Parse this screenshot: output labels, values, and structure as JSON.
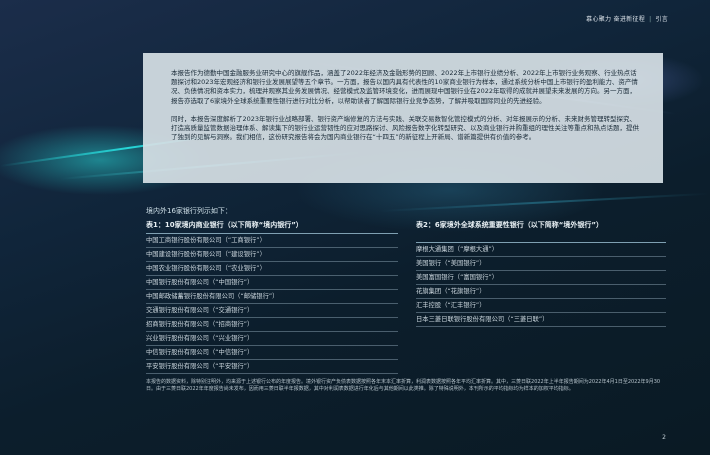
{
  "header": {
    "title": "慕心聚力 奋进新征程",
    "section": "引言"
  },
  "intro": {
    "paragraph1": "本报告作为德勤中国金融服务业研究中心的旗舰作品，涵盖了2022年经济及金融形势的回顾、2022年上市银行业绩分析、2022年上市银行业务观察、行业热点话题探讨和2023年宏观经济和银行业发展展望等五个章节。一方面，报告以国内具有代表性的10家商业银行为样本，通过系统分析中国上市银行的盈利能力、资产情况、负债情况和资本实力，梳理并观察其业务发展情况、经营模式及监管环境变化，进而展现中国银行业在2022年取得的成就并展望未来发展的方向。另一方面，报告亦选取了6家境外全球系统重要性银行进行对比分析，以帮助读者了解国际银行业竞争态势，了解并吸取国际同业的先进经验。",
    "paragraph2": "同时，本报告深度解析了2023年银行业战略部署、银行资产端修复的方法与实践、关联交易数智化管控模式的分析、对年报展示的分析、未来财务管理转型探究、打造高质量监管数据治理体系、解读集下的银行业运营韧性的应对思路探讨、风险报告数字化转型研究、以及商业银行并购重组的理性关注等重点和热点话题，提供了独到的见解与洞察。我们相信，这份研究报告将会为国内商业银行在“十四五”的新征程上开新局、谱新篇提供有价值的参考。"
  },
  "lead": "境内外16家银行列示如下：",
  "table_left": {
    "title": "表1：10家境内商业银行（以下简称“境内银行”）",
    "rows": [
      "中国工商银行股份有限公司（“工商银行”）",
      "中国建设银行股份有限公司（“建设银行”）",
      "中国农业银行股份有限公司（“农业银行”）",
      "中国银行股份有限公司（“中国银行”）",
      "中国邮政储蓄银行股份有限公司（“邮储银行”）",
      "交通银行股份有限公司（“交通银行”）",
      "招商银行股份有限公司（“招商银行”）",
      "兴业银行股份有限公司（“兴业银行”）",
      "中信银行股份有限公司（“中信银行”）",
      "平安银行股份有限公司（“平安银行”）"
    ]
  },
  "table_right": {
    "title": "表2：6家境外全球系统重要性银行（以下简称“境外银行”）",
    "rows": [
      "摩根大通集团（“摩根大通”）",
      "美国银行（“美国银行”）",
      "美国富国银行（“富国银行”）",
      "花旗集团（“花旗银行”）",
      "汇丰控股（“汇丰银行”）",
      "日本三菱日联银行股份有限公司（“三菱日联”）"
    ]
  },
  "footnote": "本报告的数据资料，除特别注明外，均来源于上述银行公布的年度报告。境外银行资产负债表数据按照各年末本汇率折算，利润表数据按照各年平均汇率折算。其中，三菱日联2022年上半年报告期间为2022年4月1日至2022年9月30日。由于三菱日联2022年年度报告尚未发布，因而用三菱日联半年报数据，其中对利润表数据进行年化后与其他期间以此类推。除了特殊说明外，本刊所示的平均指标均为样本的加权平均指标。",
  "page_number": "2"
}
